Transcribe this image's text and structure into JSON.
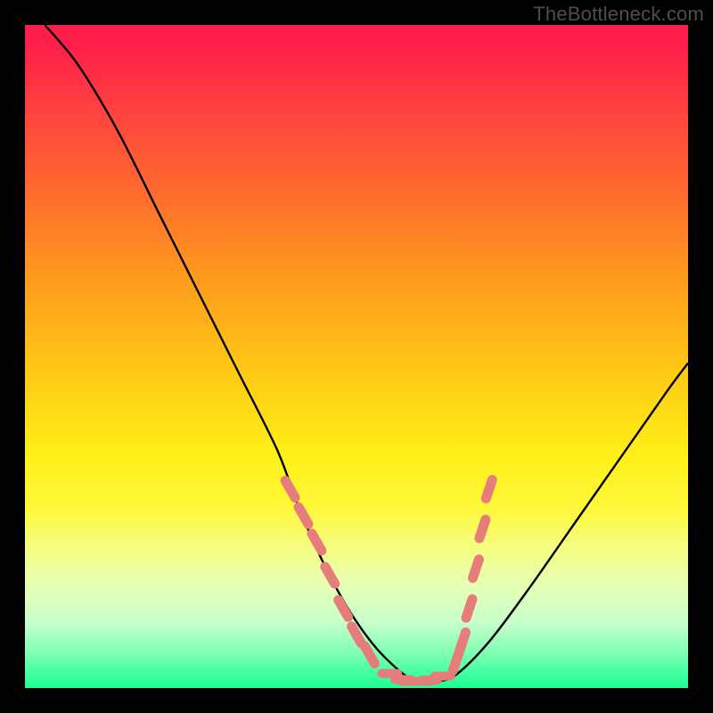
{
  "watermark": "TheBottleneck.com",
  "colors": {
    "frame": "#000000",
    "curve": "#000000",
    "marker": "#e77d7a",
    "gradient_top": "#ff1e4a",
    "gradient_bottom": "#1cff90"
  },
  "chart_data": {
    "type": "line",
    "title": "",
    "xlabel": "",
    "ylabel": "",
    "xlim": [
      0,
      100
    ],
    "ylim": [
      0,
      100
    ],
    "x": [
      3,
      8,
      14,
      20,
      26,
      32,
      38,
      41,
      44,
      47,
      50,
      53,
      56,
      58,
      60,
      62,
      65,
      70,
      76,
      83,
      90,
      97,
      100
    ],
    "y": [
      100,
      94,
      84,
      72,
      60,
      48,
      36,
      28,
      21,
      15,
      10,
      6,
      3,
      1.5,
      1,
      1,
      2,
      7,
      15,
      25,
      35,
      45,
      49
    ],
    "markers": {
      "left_cluster": {
        "x": [
          40,
          42,
          44,
          46,
          48,
          50,
          52
        ],
        "y": [
          30,
          26,
          22,
          17,
          12,
          8,
          5
        ]
      },
      "bottom_cluster": {
        "x": [
          55,
          57,
          58,
          60,
          61,
          63
        ],
        "y": [
          2.2,
          1.3,
          1,
          1,
          1.2,
          1.8
        ]
      },
      "right_cluster": {
        "x": [
          65,
          66,
          67,
          68,
          69,
          70
        ],
        "y": [
          4,
          7,
          12,
          18,
          24,
          30
        ]
      }
    }
  }
}
